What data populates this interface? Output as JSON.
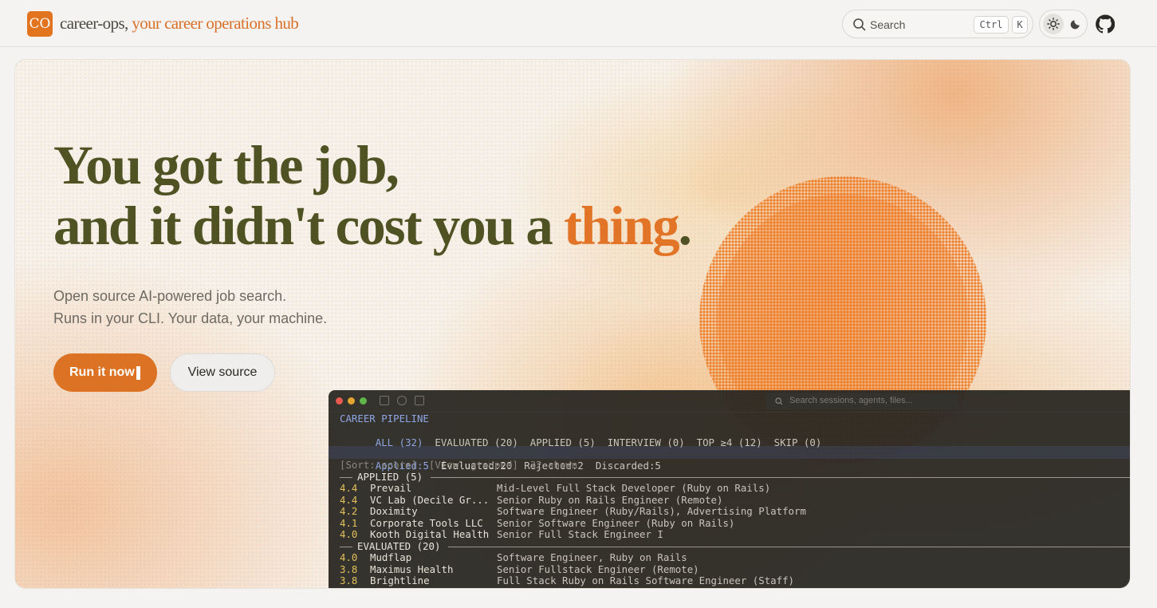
{
  "header": {
    "logo_badge": "CO",
    "brand_name": "career-ops,",
    "brand_tagline": " your career operations hub",
    "search_placeholder": "Search",
    "shortcut_ctrl": "Ctrl",
    "shortcut_k": "K",
    "theme_light_icon": "sun-icon",
    "theme_dark_icon": "moon-icon",
    "github_icon": "github-icon"
  },
  "hero": {
    "headline_line1": "You got the job,",
    "headline_line2_pre": "and it didn't cost you a ",
    "headline_accent": "thing",
    "headline_end": ".",
    "sub_line1": "Open source AI-powered job search.",
    "sub_line2": "Runs in your CLI. Your data, your machine.",
    "primary_button": "Run it now",
    "secondary_button": "View source",
    "accent_color": "#e27427"
  },
  "terminal": {
    "search_placeholder": "Search sessions, agents, files...",
    "title": "CAREER PIPELINE",
    "tabs": [
      "ALL (32)",
      "EVALUATED (20)",
      "APPLIED (5)",
      "INTERVIEW (0)",
      "TOP ≥4 (12)",
      "SKIP (0)"
    ],
    "stats": {
      "applied": "Applied:5",
      "evaluated": "Evaluated:20",
      "rejected": "Rejected:2",
      "discarded": "Discarded:5"
    },
    "sort_line": "[Sort: score]  [View: grouped]  32 shown",
    "groups": [
      {
        "label": "APPLIED (5)",
        "rows": [
          {
            "score": "4.4",
            "company": "Prevail",
            "role": "Mid-Level Full Stack Developer (Ruby on Rails)"
          },
          {
            "score": "4.4",
            "company": "VC Lab (Decile Gr...",
            "role": "Senior Ruby on Rails Engineer (Remote)"
          },
          {
            "score": "4.2",
            "company": "Doximity",
            "role": "Software Engineer (Ruby/Rails), Advertising Platform"
          },
          {
            "score": "4.1",
            "company": "Corporate Tools LLC",
            "role": "Senior Software Engineer (Ruby on Rails)"
          },
          {
            "score": "4.0",
            "company": "Kooth Digital Health",
            "role": "Senior Full Stack Engineer I"
          }
        ]
      },
      {
        "label": "EVALUATED (20)",
        "rows": [
          {
            "score": "4.0",
            "company": "Mudflap",
            "role": "Software Engineer, Ruby on Rails"
          },
          {
            "score": "3.8",
            "company": "Maximus Health",
            "role": "Senior Fullstack Engineer (Remote)"
          },
          {
            "score": "3.8",
            "company": "Brightline",
            "role": "Full Stack Ruby on Rails Software Engineer (Staff)"
          }
        ]
      }
    ]
  }
}
